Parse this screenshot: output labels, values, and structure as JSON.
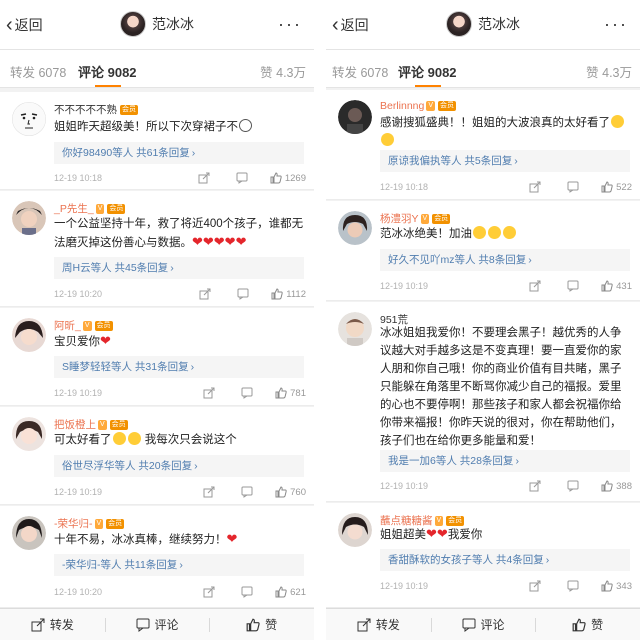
{
  "left": {
    "topbar": {
      "back_label": "返回",
      "title": "范冰冰",
      "more": "···"
    },
    "tabs": {
      "repost": "转发 6078",
      "comment": "评论 9082",
      "like": "赞 4.3万"
    },
    "comments": [
      {
        "username": "不不不不不熟",
        "badge": "",
        "text": "姐姐昨天超级美！所以下次穿裙子不",
        "replies": "你好98490等人  共61条回复",
        "time": "12-19 10:18",
        "likes": "1269"
      },
      {
        "username": "_P先生_",
        "badge": "V",
        "text": "一个公益坚持十年，救了将近400个孩子，谁都无法磨灭掉这份善心与数据。",
        "replies": "周H云等人  共45条回复",
        "time": "12-19 10:20",
        "likes": "1112"
      },
      {
        "username": "阿昕_",
        "badge": "V",
        "text": "宝贝爱你",
        "replies": "S睡梦轻轻等人  共31条回复",
        "time": "12-19 10:19",
        "likes": "781"
      },
      {
        "username": "把饭橙上",
        "badge": "V",
        "text": "可太好看了",
        "text2": "我每次只会说这个",
        "replies": "俗世尽浮华等人  共20条回复",
        "time": "12-19 10:19",
        "likes": "760"
      },
      {
        "username": "-荣华归-",
        "badge": "V",
        "text": "十年不易，冰冰真棒，继续努力！",
        "replies": "-荣华归-等人  共11条回复",
        "time": "12-19 10:20",
        "likes": "621"
      }
    ],
    "bottombar": {
      "repost": "转发",
      "comment": "评论",
      "like": "赞"
    }
  },
  "right": {
    "topbar": {
      "back_label": "返回",
      "title": "范冰冰",
      "more": "···"
    },
    "tabs": {
      "repost": "转发 6078",
      "comment": "评论 9082",
      "like": "赞 4.3万"
    },
    "comments": [
      {
        "username": "Berlinnng",
        "badge": "V",
        "text": "感谢搜狐盛典！！姐姐的大波浪真的太好看了",
        "replies": "原谅我偏执等人  共5条回复",
        "time": "12-19 10:18",
        "likes": "522"
      },
      {
        "username": "杨澧羽Y",
        "badge": "V",
        "text": "范冰冰绝美！加油",
        "replies": "好久不见吖mz等人  共8条回复",
        "time": "12-19 10:19",
        "likes": "431"
      },
      {
        "username": "951荒",
        "badge": "",
        "text": "冰冰姐姐我爱你！不要理会黑子！越优秀的人争议越大对手越多这是不变真理！要一直爱你的家人朋和你自己哦！你的商业价值有目共睹，黑子只能躲在角落里不断骂你减少自己的福报。爱里的心也不要停啊！那些孩子和家人都会祝福你给你带来福报！你昨天说的很对，你在帮助他们，孩子们也在给你更多能量和爱！",
        "replies": "我是一加6等人  共28条回复",
        "time": "12-19 10:19",
        "likes": "388"
      },
      {
        "username": "蘸点糖糖酱",
        "badge": "V",
        "text": "姐姐超美",
        "text2": "我爱你",
        "replies": "香甜酥软的女孩子等人  共4条回复",
        "time": "12-19 10:19",
        "likes": "343"
      }
    ],
    "bottombar": {
      "repost": "转发",
      "comment": "评论",
      "like": "赞"
    }
  }
}
